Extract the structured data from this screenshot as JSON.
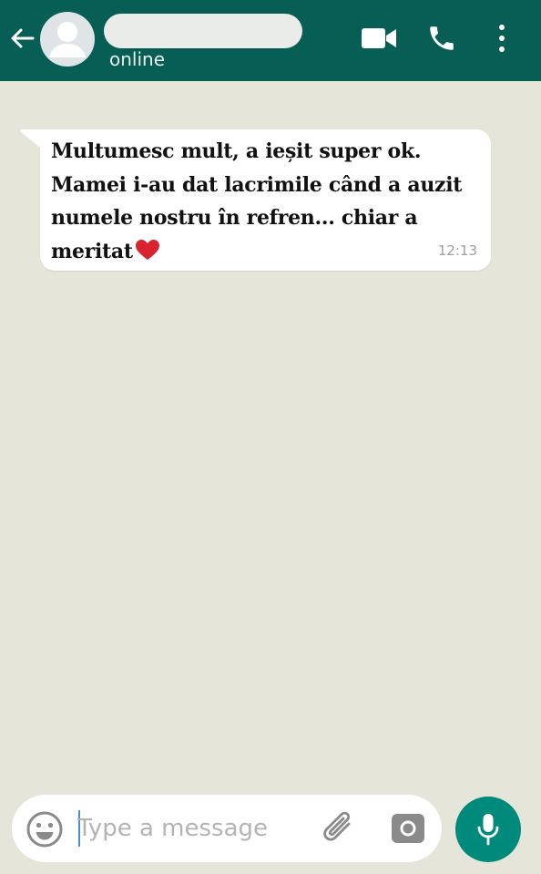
{
  "header": {
    "status": "online"
  },
  "message": {
    "lines": [
      "Multumesc mult, a ieșit super ok.",
      "Mamei i-au dat lacrimile când a auzit",
      "numele nostru în refren... chiar a",
      "meritat"
    ],
    "time": "12:13",
    "emoji": "heart-icon"
  },
  "composer": {
    "placeholder": "Type a message"
  },
  "colors": {
    "header": "#075e54",
    "background": "#e6e5d9",
    "bubble": "#ffffff",
    "mic_button": "#008a7b",
    "heart": "#d9232f"
  }
}
